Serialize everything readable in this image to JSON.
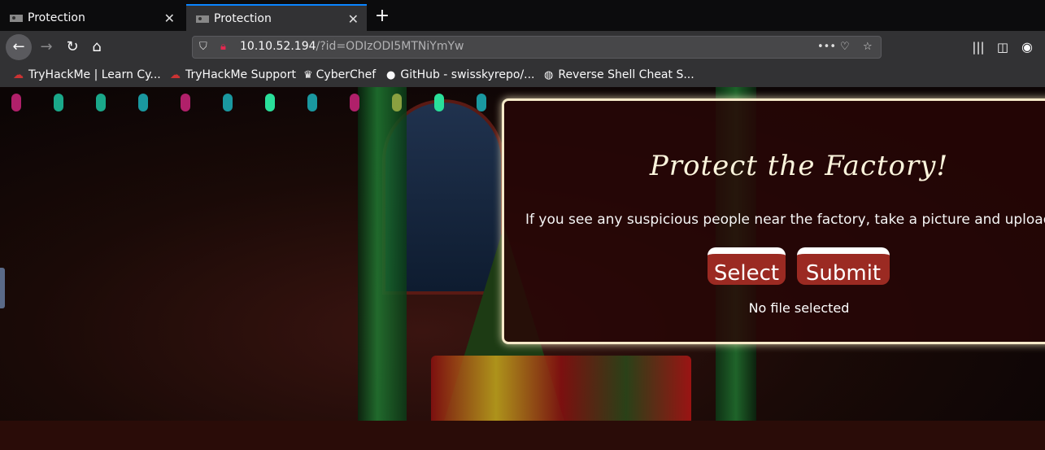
{
  "tabs": [
    {
      "title": "Protection",
      "active": false
    },
    {
      "title": "Protection",
      "active": true
    }
  ],
  "nav": {
    "url_host": "10.10.52.194",
    "url_path": "/?id=ODIzODI5MTNiYmYw"
  },
  "bookmarks": [
    {
      "label": "TryHackMe | Learn Cy...",
      "icon": "cloud-icon"
    },
    {
      "label": "TryHackMe Support",
      "icon": "cloud-icon"
    },
    {
      "label": "CyberChef",
      "icon": "chef-icon"
    },
    {
      "label": "GitHub - swisskyrepo/...",
      "icon": "github-icon"
    },
    {
      "label": "Reverse Shell Cheat S...",
      "icon": "globe-icon"
    }
  ],
  "panel": {
    "title": "Protect the Factory!",
    "text": "If you see any suspicious people near the factory, take a picture and upload it h",
    "select_label": "Select",
    "submit_label": "Submit",
    "file_status": "No file selected"
  },
  "colors": {
    "accent": "#0a84ff",
    "button": "#9b2a22",
    "panel_border": "#f5e9c8"
  }
}
